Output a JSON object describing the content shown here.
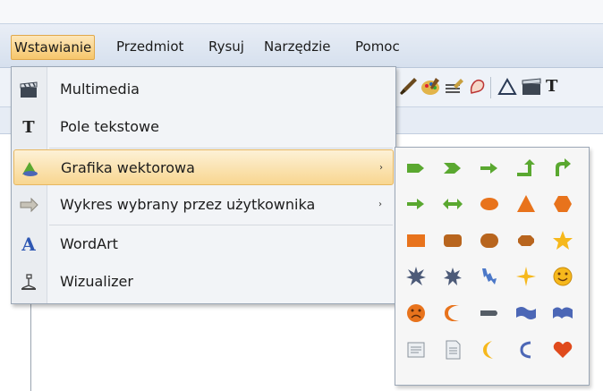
{
  "menubar": {
    "items": [
      {
        "label": "Wstawianie",
        "active": true
      },
      {
        "label": "Przedmiot",
        "active": false
      },
      {
        "label": "Rysuj",
        "active": false
      },
      {
        "label": "Narzędzie",
        "active": false
      },
      {
        "label": "Pomoc",
        "active": false
      }
    ]
  },
  "toolbar": {
    "icons": [
      "brush-icon",
      "palette-icon",
      "edit-icon",
      "shape-icon",
      "triangle-icon",
      "multimedia-icon",
      "text-icon"
    ],
    "text_tool_label": "T"
  },
  "insert_menu": {
    "items": [
      {
        "label": "Multimedia",
        "icon": "clapperboard-icon"
      },
      {
        "label": "Pole tekstowe",
        "icon": "text-icon",
        "icon_glyph": "T"
      },
      {
        "label": "Grafika wektorowa",
        "icon": "vector-graphic-icon",
        "submenu": true,
        "highlighted": true
      },
      {
        "label": "Wykres wybrany przez użytkownika",
        "icon": "custom-chart-icon",
        "submenu": true
      },
      {
        "label": "WordArt",
        "icon": "wordart-icon",
        "icon_glyph": "A"
      },
      {
        "label": "Wizualizer",
        "icon": "visualizer-icon"
      }
    ]
  },
  "submenu_arrow": "›",
  "vector_submenu": {
    "shapes": [
      "arrow-pentagon-icon",
      "chevron-arrow-icon",
      "right-arrow-icon",
      "bent-up-arrow-icon",
      "turn-right-arrow-icon",
      "right-arrow-small-icon",
      "double-arrow-icon",
      "ellipse-icon",
      "triangle-icon",
      "hexagon-icon",
      "rectangle-icon",
      "rounded-rectangle-icon",
      "flowchart-terminator-icon",
      "octagon-icon",
      "star-icon",
      "explosion-icon",
      "burst-icon",
      "lightning-icon",
      "four-point-star-icon",
      "smiley-icon",
      "sad-face-icon",
      "moon-crescent-icon",
      "can-cylinder-icon",
      "wave-icon",
      "double-wave-icon",
      "note-icon",
      "document-icon",
      "crescent-moon-icon",
      "cloud-callout-icon",
      "heart-icon"
    ]
  },
  "colors": {
    "green": "#5aa830",
    "orange": "#e8731c",
    "yellow": "#f6b81c",
    "blue": "#4c67b6",
    "gray": "#808a94"
  }
}
